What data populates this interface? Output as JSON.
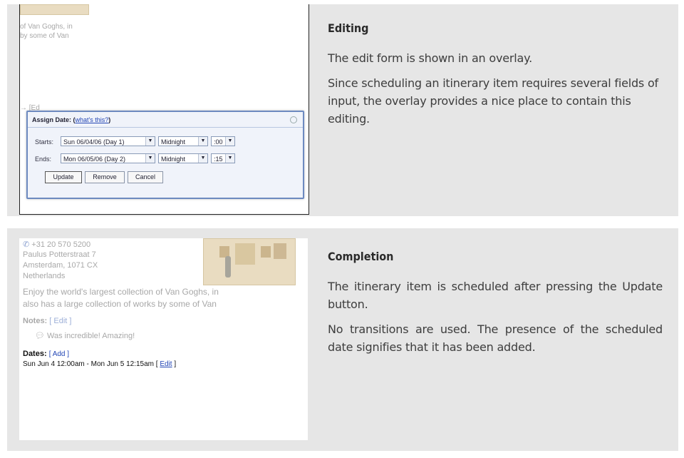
{
  "sections": [
    {
      "heading": "Editing",
      "paragraphs": [
        "The edit form is shown in an overlay.",
        "Since scheduling an itinerary item requires several fields of input, the overlay provides a nice place to contain this editing."
      ]
    },
    {
      "heading": "Completion",
      "paragraphs": [
        "The itinerary item is scheduled after pressing the Update button.",
        "No transitions are used. The presence of the scheduled date signifies that it has been added."
      ]
    }
  ],
  "editing_shot": {
    "bg_text_1": "of Van Goghs, in",
    "bg_text_2": "by some of Van",
    "bg_text_3": "→ [Ed",
    "overlay": {
      "title": "Assign Date: (",
      "link": "what's this?",
      "title_end": ")",
      "starts_label": "Starts:",
      "ends_label": "Ends:",
      "start_date": "Sun 06/04/06 (Day 1)",
      "start_time": "Midnight",
      "start_min": ":00",
      "end_date": "Mon 06/05/06 (Day 2)",
      "end_time": "Midnight",
      "end_min": ":15",
      "update": "Update",
      "remove": "Remove",
      "cancel": "Cancel"
    }
  },
  "completion_shot": {
    "phone": "+31 20 570 5200",
    "address_1": "Paulus Potterstraat 7",
    "address_2": "Amsterdam, 1071 CX",
    "address_3": "Netherlands",
    "blurb_1": "Enjoy the world's largest collection of Van Goghs, in",
    "blurb_2": "also has a large collection of works by some of Van",
    "notes_label": "Notes:",
    "notes_edit": "[ Edit ]",
    "note_text": "Was incredible! Amazing!",
    "dates_label": "Dates:",
    "dates_add": "[ Add ]",
    "dates_value": "Sun Jun 4 12:00am - Mon Jun 5 12:15am [",
    "dates_edit": "Edit",
    "dates_end": "]"
  }
}
